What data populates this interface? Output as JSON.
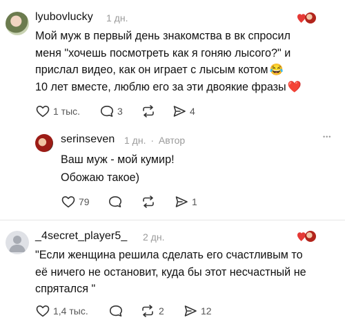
{
  "comments": [
    {
      "username": "lyubovlucky",
      "time": "1 дн.",
      "lines": [
        "Мой муж в первый день знакомства в вк спросил",
        "меня \"хочешь посмотреть как я гоняю лысого?\" и",
        "прислал видео, как он играет с лысым котом",
        "10 лет вместе, люблю его за эти двоякие фразы"
      ],
      "emoji_line3": "😂",
      "emoji_line4": "❤️",
      "likes": "1 тыс.",
      "replies": "3",
      "reposts": "",
      "shares": "4"
    },
    {
      "username": "serinseven",
      "time": "1 дн.",
      "separator": "·",
      "author_label": "Автор",
      "lines": [
        "Ваш муж - мой кумир!",
        "Обожаю такое)"
      ],
      "likes": "79",
      "replies": "",
      "reposts": "",
      "shares": "1",
      "more": "•••"
    },
    {
      "username": "_4secret_player5_",
      "time": "2 дн.",
      "lines": [
        "\"Если женщина решила сделать его счастливым то",
        "её ничего не остановит, куда бы этот несчастный не",
        "спрятался \""
      ],
      "likes": "1,4 тыс.",
      "replies": "",
      "reposts": "2",
      "shares": "12"
    }
  ],
  "colors": {
    "heart_red": "#e53935",
    "meta_gray": "#9a9a9a",
    "divider": "#e6e6e6"
  },
  "icons": [
    "heart-icon",
    "comment-icon",
    "repost-icon",
    "share-icon",
    "more-icon",
    "liked-by-author-avatar"
  ]
}
